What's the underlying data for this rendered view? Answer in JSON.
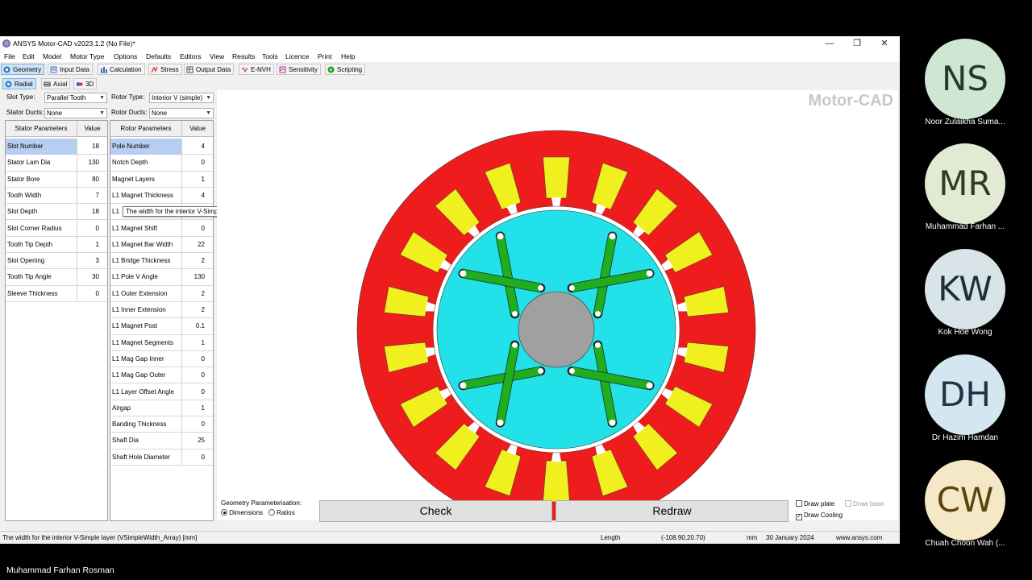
{
  "window": {
    "title": "ANSYS Motor-CAD v2023.1.2 (No File)*",
    "minimize": "—",
    "restore": "❐",
    "close": "✕"
  },
  "menu": [
    "File",
    "Edit",
    "Model",
    "Motor Type",
    "Options",
    "Defaults",
    "Editors",
    "View",
    "Results",
    "Tools",
    "Licence",
    "Print",
    "Help"
  ],
  "tabs": [
    {
      "label": "Geometry",
      "icon": "geometry-icon",
      "active": true
    },
    {
      "label": "Input Data",
      "icon": "input-data-icon"
    },
    {
      "label": "Calculation",
      "icon": "calculation-icon"
    },
    {
      "label": "Stress",
      "icon": "stress-icon"
    },
    {
      "label": "Output Data",
      "icon": "output-data-icon"
    },
    {
      "label": "E-NVH",
      "icon": "envh-icon"
    },
    {
      "label": "Sensitivity",
      "icon": "sensitivity-icon"
    },
    {
      "label": "Scripting",
      "icon": "scripting-icon"
    }
  ],
  "subtabs": [
    {
      "label": "Radial",
      "icon": "radial-icon",
      "active": true
    },
    {
      "label": "Axial",
      "icon": "axial-icon"
    },
    {
      "label": "3D",
      "icon": "3d-icon"
    }
  ],
  "selectors": {
    "slot_type_label": "Slot Type:",
    "slot_type": "Parallel Tooth",
    "stator_ducts_label": "Stator Ducts:",
    "stator_ducts": "None",
    "rotor_type_label": "Rotor Type:",
    "rotor_type": "Interior V (simple)",
    "rotor_ducts_label": "Rotor Ducts:",
    "rotor_ducts": "None"
  },
  "stator_table": {
    "headers": [
      "Stator Parameters",
      "Value"
    ],
    "rows": [
      [
        "Slot Number",
        "18"
      ],
      [
        "Stator Lam Dia",
        "130"
      ],
      [
        "Stator Bore",
        "80"
      ],
      [
        "Tooth Width",
        "7"
      ],
      [
        "Slot Depth",
        "18"
      ],
      [
        "Slot Corner Radius",
        "0"
      ],
      [
        "Tooth Tip Depth",
        "1"
      ],
      [
        "Slot Opening",
        "3"
      ],
      [
        "Tooth Tip Angle",
        "30"
      ],
      [
        "Sleeve Thickness",
        "0"
      ]
    ]
  },
  "rotor_table": {
    "headers": [
      "Rotor Parameters",
      "Value"
    ],
    "rows": [
      [
        "Pole Number",
        "4"
      ],
      [
        "Notch Depth",
        "0"
      ],
      [
        "Magnet Layers",
        "1"
      ],
      [
        "L1 Magnet Thickness",
        "4"
      ],
      [
        "L1",
        ""
      ],
      [
        "L1 Magnet Shift",
        "0"
      ],
      [
        "L1 Magnet Bar Width",
        "22"
      ],
      [
        "L1 Bridge Thickness",
        "2"
      ],
      [
        "L1 Pole V Angle",
        "130"
      ],
      [
        "L1 Outer Extension",
        "2"
      ],
      [
        "L1 Inner Extension",
        "2"
      ],
      [
        "L1 Magnet Post",
        "0.1"
      ],
      [
        "L1 Magnet Segments",
        "1"
      ],
      [
        "L1 Mag Gap Inner",
        "0"
      ],
      [
        "L1 Mag Gap Outer",
        "0"
      ],
      [
        "L1 Layer Offset Angle",
        "0"
      ],
      [
        "Airgap",
        "1"
      ],
      [
        "Banding Thickness",
        "0"
      ],
      [
        "Shaft Dia",
        "25"
      ],
      [
        "Shaft Hole Diameter",
        "0"
      ]
    ]
  },
  "tooltip": "The width for the interior V-Simple layer",
  "canvas": {
    "watermark": "Motor-CAD",
    "slots": 18,
    "poles": 4,
    "colors": {
      "stator": "#ee1c1c",
      "winding": "#f0f01e",
      "rotor": "#23e1e8",
      "magnet": "#1fae1f",
      "shaft": "#a0a0a0"
    }
  },
  "bottom": {
    "geo_param_label": "Geometry Parameterisation:",
    "dimensions": "Dimensions",
    "ratios": "Ratios",
    "check": "Check",
    "redraw": "Redraw",
    "draw_plate": "Draw plate",
    "draw_base": "Draw base",
    "draw_cooling": "Draw Cooling",
    "draw_cooling_checked": true
  },
  "status": {
    "hint": "The width for the interior V-Simple layer (VSimpleWidth_Array) [mm]",
    "length": "Length",
    "coords": "(-108.90,20.70)",
    "unit": "mm",
    "date": "30 January 2024",
    "url": "www.ansys.com"
  },
  "participants": [
    {
      "initials": "NS",
      "name": "Noor Zulaikha Suma...",
      "bg": "#cfe6d3",
      "fg": "#1f3d2a"
    },
    {
      "initials": "MR",
      "name": "Muhammad Farhan ...",
      "bg": "#e2ead3",
      "fg": "#2e3d1f"
    },
    {
      "initials": "KW",
      "name": "Kok Hoe Wong",
      "bg": "#d9e4e9",
      "fg": "#1d2f3a"
    },
    {
      "initials": "DH",
      "name": "Dr Hazim Hamdan",
      "bg": "#d4e7f0",
      "fg": "#1c3645"
    },
    {
      "initials": "CW",
      "name": "Chuah Choon Wah (...",
      "bg": "#f5e8c6",
      "fg": "#5a4310"
    }
  ],
  "self_name": "Muhammad Farhan Rosman"
}
